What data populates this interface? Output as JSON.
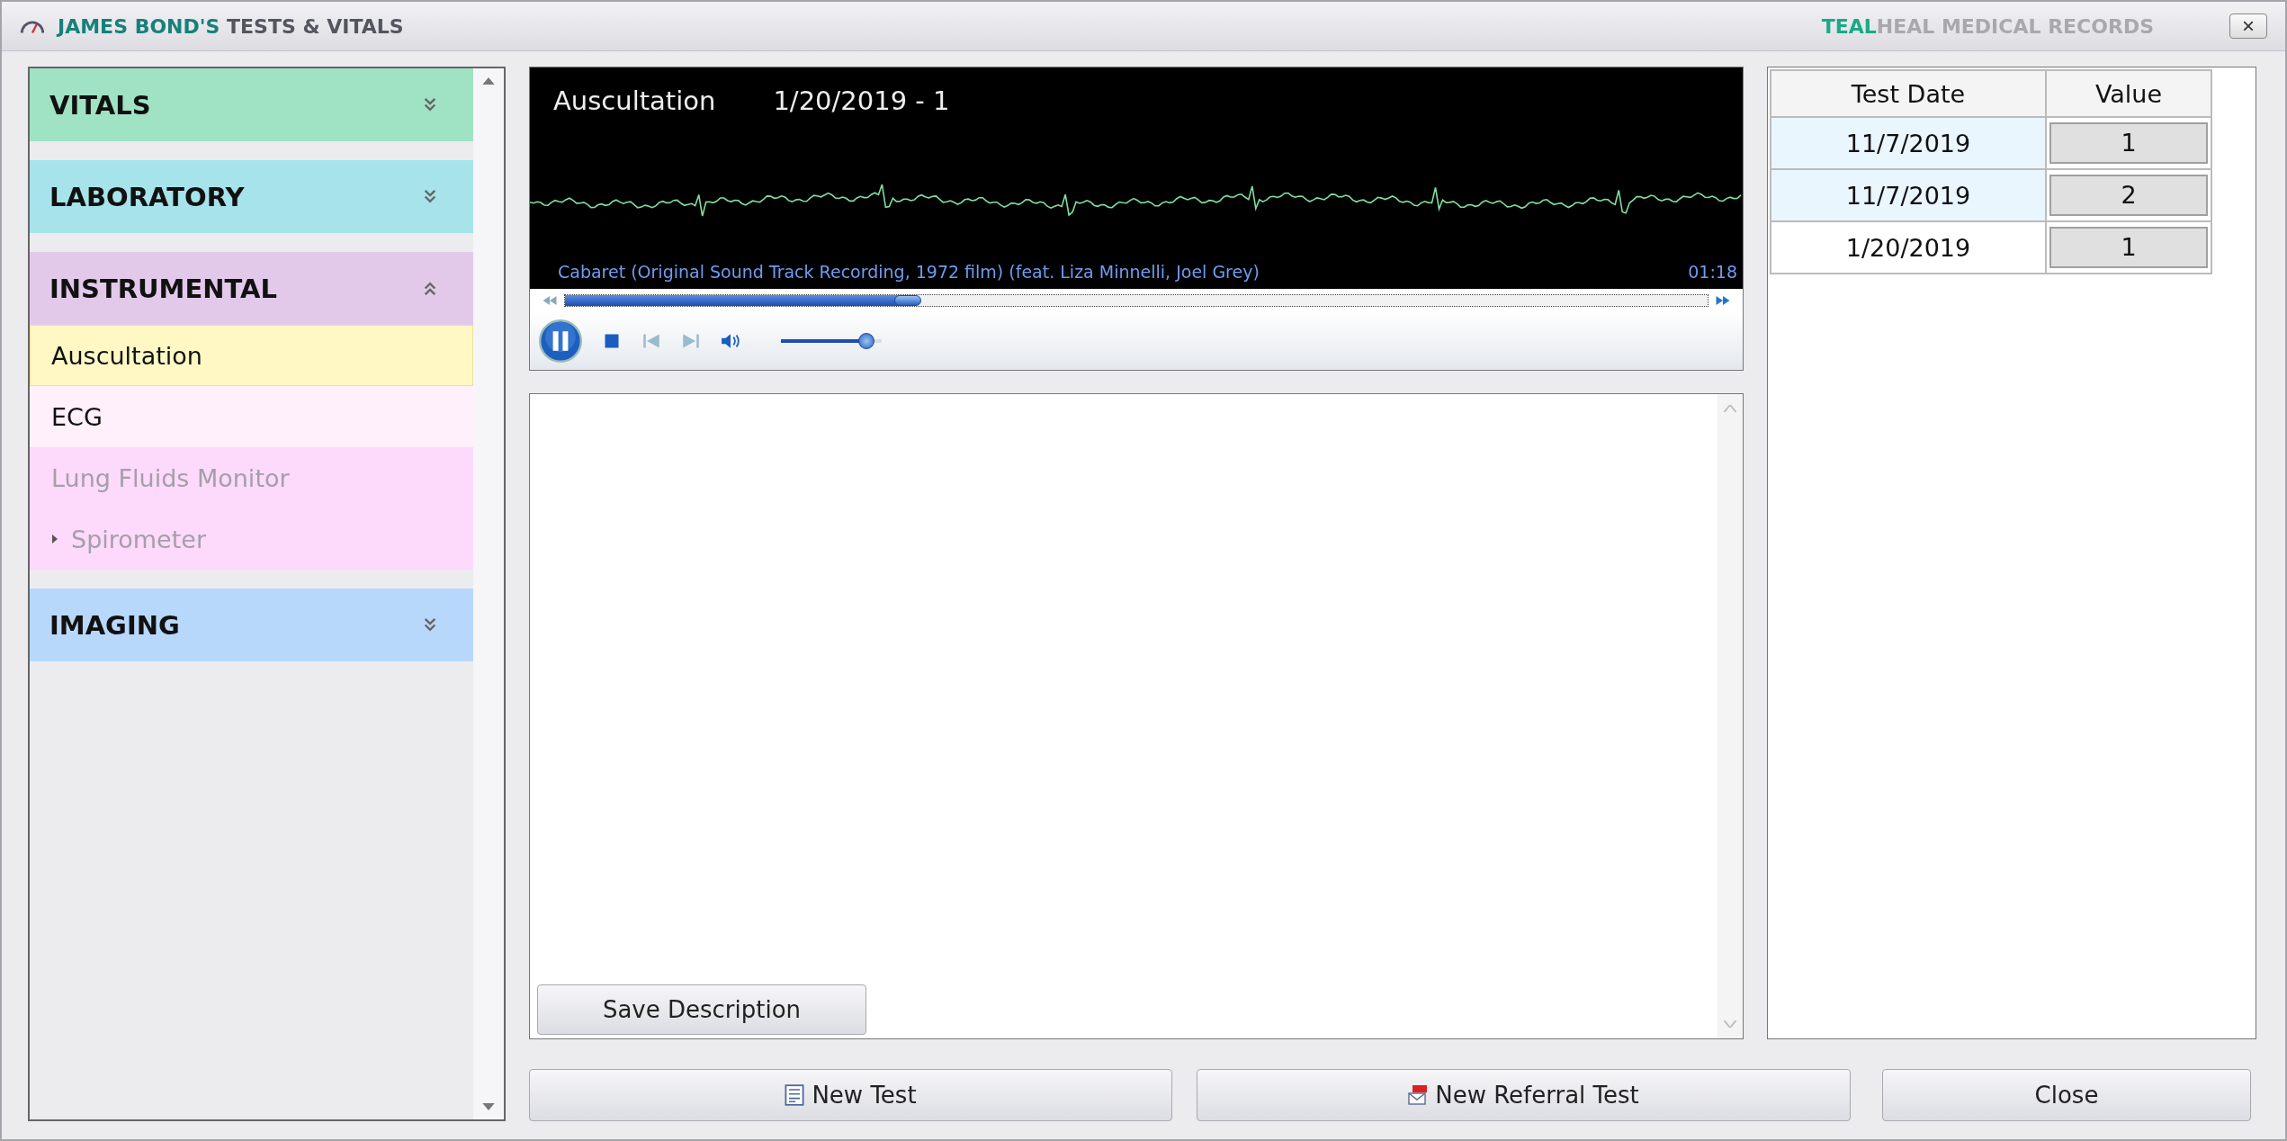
{
  "window": {
    "title_highlight": "JAMES BOND'S",
    "title": "TESTS & VITALS",
    "brand_highlight": "TEAL",
    "brand": "HEAL MEDICAL RECORDS",
    "close": "×"
  },
  "sidebar": {
    "sections": [
      {
        "label": "VITALS",
        "color": "#a0e2c4",
        "expanded": false
      },
      {
        "label": "LABORATORY",
        "color": "#a6e3ea",
        "expanded": false
      },
      {
        "label": "INSTRUMENTAL",
        "color": "#e2c9ea",
        "expanded": true,
        "items": [
          {
            "label": "Auscultation",
            "color": "#fff8c4",
            "selected": true,
            "disabled": false
          },
          {
            "label": "ECG",
            "color": "#fff0fc",
            "selected": false,
            "disabled": false
          },
          {
            "label": "Lung Fluids Monitor",
            "color": "#fdd9fb",
            "selected": false,
            "disabled": true
          },
          {
            "label": "Spirometer",
            "color": "#fdd9fb",
            "selected": false,
            "disabled": true,
            "expanded": false
          }
        ]
      },
      {
        "label": "IMAGING",
        "color": "#b8d8fb",
        "expanded": false
      }
    ]
  },
  "player": {
    "title": "Auscultation",
    "date": "1/20/2019 - 1",
    "track": "Cabaret (Original Sound Track Recording, 1972 film) (feat. Liza Minnelli, Joel Grey)",
    "time": "01:18",
    "playing": true,
    "seek": {
      "level": 0.3
    },
    "volume": {
      "level": 0.85
    }
  },
  "description": {
    "save_button": "Save Description"
  },
  "table": {
    "columns": [
      "Test Date",
      "Value"
    ],
    "rows": [
      {
        "date": "11/7/2019",
        "value": "1",
        "selected": true
      },
      {
        "date": "11/7/2019",
        "value": "2",
        "selected": true
      },
      {
        "date": "1/20/2019",
        "value": "1",
        "selected": false
      }
    ]
  },
  "buttons": [
    {
      "label": "New Test",
      "kind": "form"
    },
    {
      "label": "New Referral Test",
      "kind": "pdf"
    },
    {
      "label": "Close",
      "kind": "plain"
    }
  ]
}
